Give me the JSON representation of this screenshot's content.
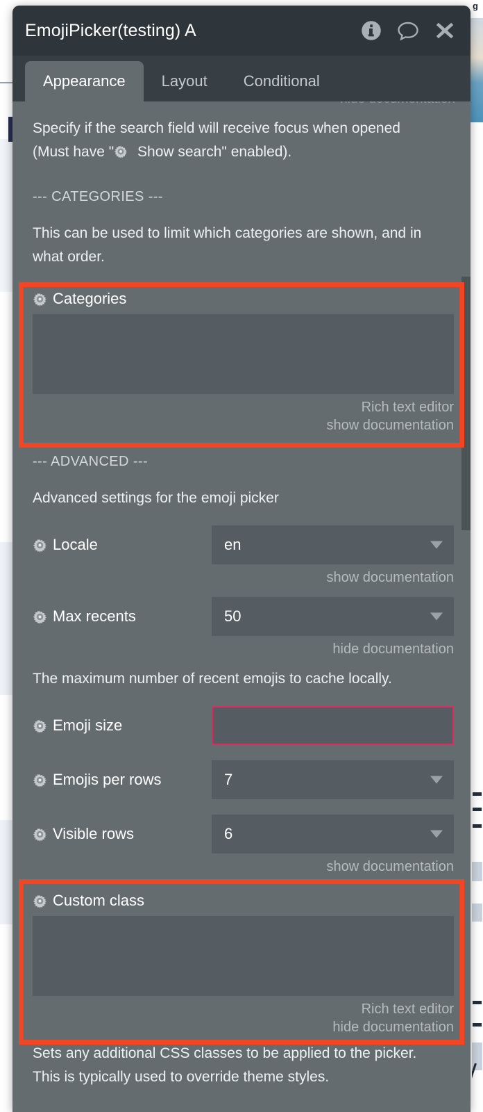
{
  "window": {
    "title": "EmojiPicker(testing) A",
    "icons": [
      {
        "name": "info-icon",
        "label": "Information"
      },
      {
        "name": "comment-icon",
        "label": "Comments"
      },
      {
        "name": "close-icon",
        "label": "Close"
      }
    ]
  },
  "tabs": [
    {
      "id": "appearance",
      "label": "Appearance",
      "active": true
    },
    {
      "id": "layout",
      "label": "Layout",
      "active": false
    },
    {
      "id": "conditional",
      "label": "Conditional",
      "active": false
    }
  ],
  "content": {
    "clipped_doc_link": "hide documentation",
    "search_focus_doc": "Specify if the search field will receive focus when opened (Must have \"⚙ Show search\" enabled).",
    "search_focus_doc_part1": "Specify if the search field will receive focus when opened",
    "search_focus_doc_part2a": "(Must have \"",
    "search_focus_doc_part2b": " Show search\" enabled).",
    "categories_section_header": "--- CATEGORIES ---",
    "categories_doc": "This can be used to limit which categories are shown, and in what order.",
    "categories_field": {
      "label": "Categories",
      "value": "",
      "editor_hint": "Rich text editor",
      "doc_link": "show documentation"
    },
    "advanced_section_header": "--- ADVANCED ---",
    "advanced_doc": "Advanced settings for the emoji picker",
    "locale_field": {
      "label": "Locale",
      "value": "en",
      "doc_link": "show documentation"
    },
    "max_recents_field": {
      "label": "Max recents",
      "value": "50",
      "doc_link": "hide documentation",
      "doc_text": "The maximum number of recent emojis to cache locally."
    },
    "emoji_size_field": {
      "label": "Emoji size",
      "value": ""
    },
    "emojis_per_rows_field": {
      "label": "Emojis per rows",
      "value": "7"
    },
    "visible_rows_field": {
      "label": "Visible rows",
      "value": "6",
      "doc_link": "show documentation"
    },
    "custom_class_field": {
      "label": "Custom class",
      "value": "",
      "editor_hint": "Rich text editor",
      "doc_link": "hide documentation",
      "doc_text": "Sets any additional CSS classes to be applied to the picker. This is typically used to override theme styles.",
      "doc_text_line1": "Sets any additional CSS classes to be applied to the picker.",
      "doc_text_line2": "This is typically used to override theme styles."
    }
  },
  "colors": {
    "titlebar_bg": "#2f363b",
    "tabbar_bg": "#373e44",
    "panel_bg": "#646c70",
    "input_bg": "#555d62",
    "highlight_red": "#f04623",
    "focus_pink": "#e02a5b",
    "text_primary": "#ffffff",
    "text_muted": "#b5bbbf",
    "scrollbar_thumb": "#4c5357"
  },
  "background": {
    "edge_text": "g"
  }
}
